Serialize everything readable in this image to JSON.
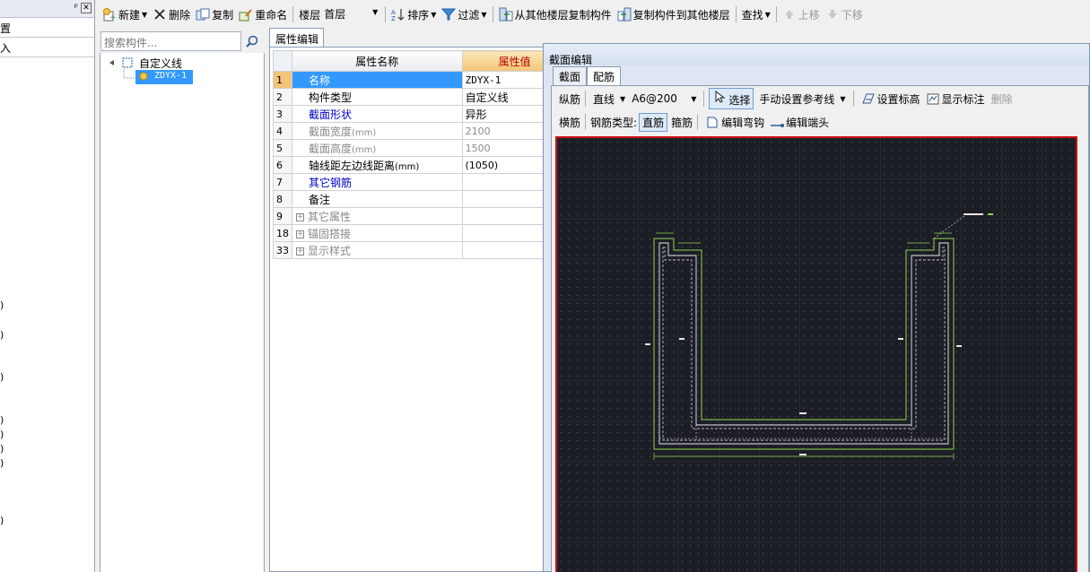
{
  "left_panel": {
    "row1": "置",
    "row2": "入",
    "parens": [
      ")",
      ")",
      ")",
      ")",
      ")",
      ")",
      ")",
      ")"
    ]
  },
  "toolbar": {
    "new": "新建",
    "delete": "删除",
    "copy": "复制",
    "rename": "重命名",
    "floor_label": "楼层",
    "floor_value": "首层",
    "sort": "排序",
    "filter": "过滤",
    "copy_from_floor": "从其他楼层复制构件",
    "copy_to_floor": "复制构件到其他楼层",
    "find": "查找",
    "move_up": "上移",
    "move_down": "下移"
  },
  "search": {
    "placeholder": "搜索构件..."
  },
  "tree": {
    "root": "自定义线",
    "child": "ZDYX-1"
  },
  "property_editor": {
    "tab": "属性编辑",
    "headers": {
      "name": "属性名称",
      "value": "属性值"
    },
    "rows": [
      {
        "idx": "1",
        "name": "名称",
        "value": "ZDYX-1"
      },
      {
        "idx": "2",
        "name": "构件类型",
        "value": "自定义线"
      },
      {
        "idx": "3",
        "name": "截面形状",
        "value": "异形"
      },
      {
        "idx": "4",
        "name": "截面宽度",
        "unit": "(mm)",
        "value": "2100"
      },
      {
        "idx": "5",
        "name": "截面高度",
        "unit": "(mm)",
        "value": "1500"
      },
      {
        "idx": "6",
        "name": "轴线距左边线距离",
        "unit": "(mm)",
        "value": "(1050)"
      },
      {
        "idx": "7",
        "name": "其它钢筋",
        "value": ""
      },
      {
        "idx": "8",
        "name": "备注",
        "value": ""
      },
      {
        "idx": "9",
        "name": "其它属性",
        "value": ""
      },
      {
        "idx": "18",
        "name": "锚固搭接",
        "value": ""
      },
      {
        "idx": "33",
        "name": "显示样式",
        "value": ""
      }
    ]
  },
  "section_editor": {
    "title": "截面编辑",
    "tabs": [
      "截面",
      "配筋"
    ],
    "row1": {
      "label": "纵筋",
      "line_type": "直线",
      "spec": "A6@200",
      "select": "选择",
      "manual_ref": "手动设置参考线",
      "set_elevation": "设置标高",
      "show_marks": "显示标注",
      "delete": "删除"
    },
    "row2": {
      "label": "横筋",
      "type_label": "钢筋类型:",
      "straight": "直筋",
      "stirrup": "箍筋",
      "edit_hook": "编辑弯钩",
      "edit_end": "编辑端头"
    }
  },
  "colors": {
    "canvas_bg": "#1c1e26",
    "profile": "#8fd14f",
    "canvas_border": "#cc1010",
    "selection": "#3399ff"
  }
}
